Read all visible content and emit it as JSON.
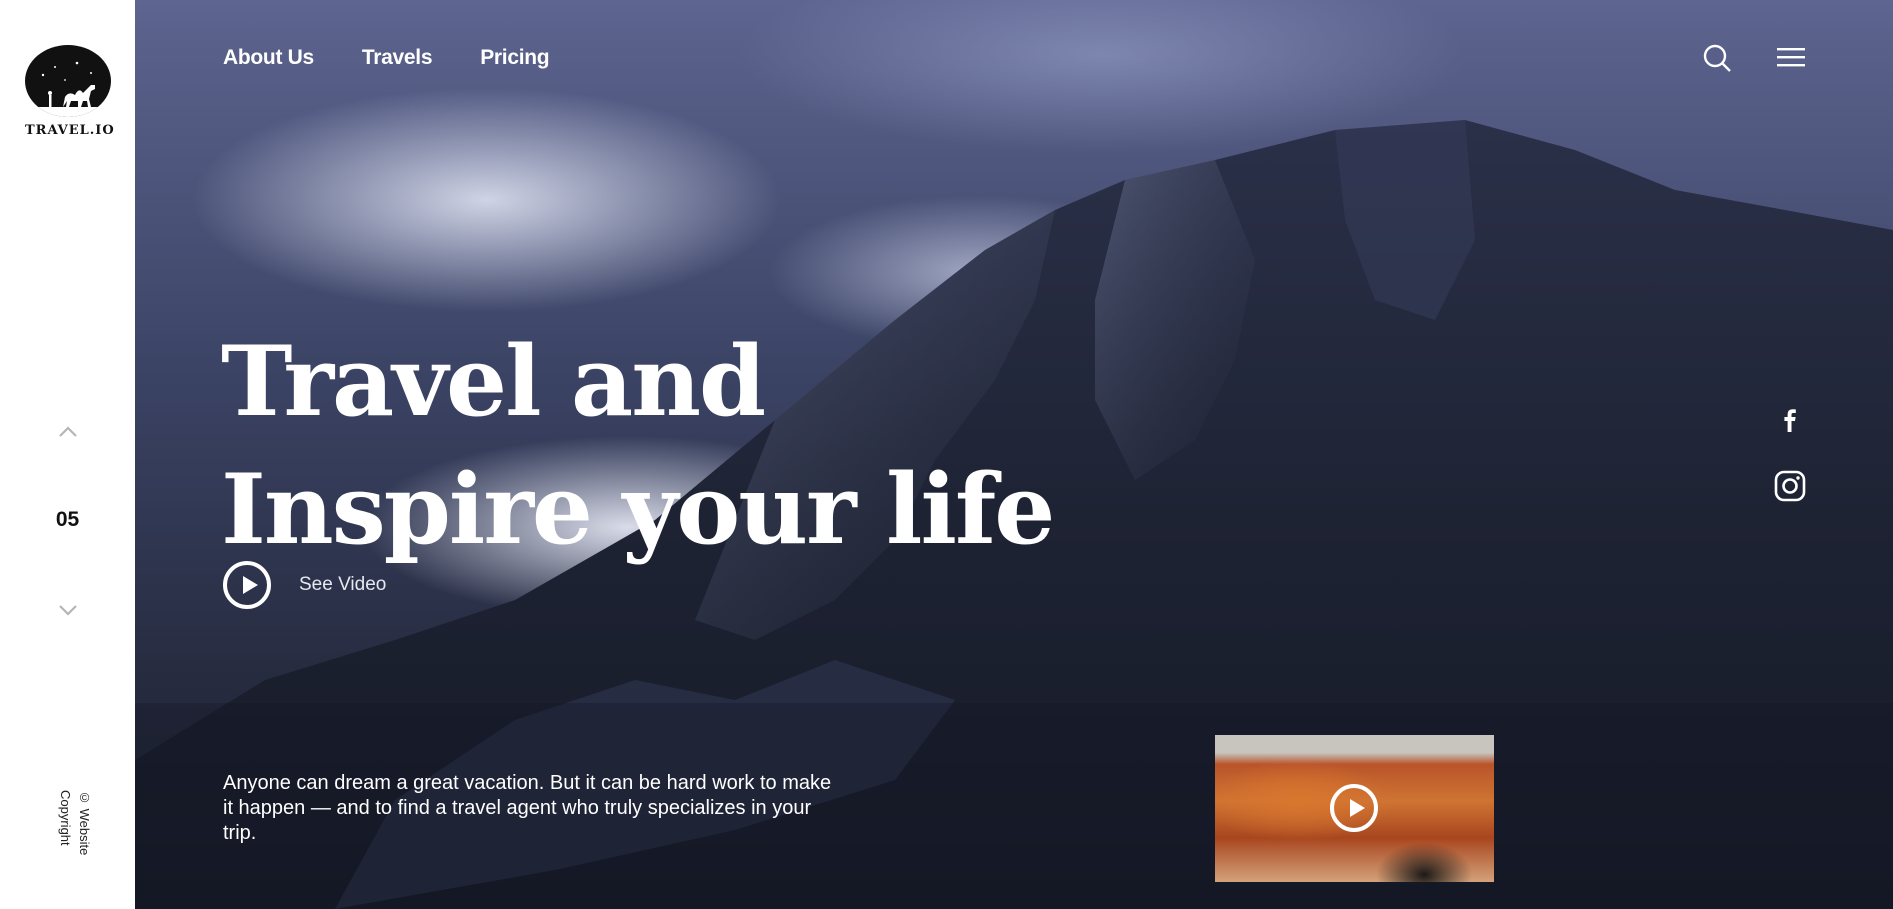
{
  "brand": {
    "name": "TRAVEL.IO",
    "logo_icon": "camel-night-logo"
  },
  "nav": {
    "items": [
      {
        "label": "About Us"
      },
      {
        "label": "Travels"
      },
      {
        "label": "Pricing"
      }
    ],
    "search_icon": "search-icon",
    "menu_icon": "hamburger-menu-icon"
  },
  "slider": {
    "current": "05",
    "up_icon": "chevron-up-icon",
    "down_icon": "chevron-down-icon"
  },
  "hero": {
    "headline_line1": "Travel and",
    "headline_line2": "Inspire your life",
    "video_label": "See Video",
    "description": "Anyone can dream a great vacation. But it can be hard work to make it happen — and to find a travel agent who truly specializes in your trip."
  },
  "social": {
    "facebook_icon": "facebook-icon",
    "instagram_icon": "instagram-icon"
  },
  "footer": {
    "copyright": "© Website Copyright"
  },
  "colors": {
    "sidebar_bg": "#ffffff",
    "text_light": "#ffffff",
    "text_dark": "#111111"
  }
}
